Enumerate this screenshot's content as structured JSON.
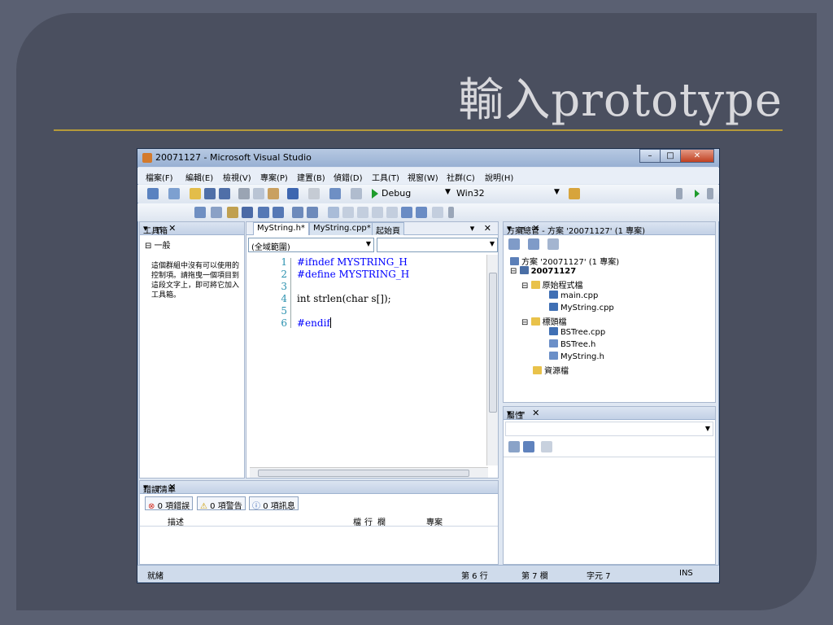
{
  "slide": {
    "title": "輸入prototype"
  },
  "window": {
    "title": "20071127 - Microsoft Visual Studio",
    "minimize": "–",
    "maximize": "□",
    "close": "✕"
  },
  "menu": [
    "檔案(F)",
    "編輯(E)",
    "檢視(V)",
    "專案(P)",
    "建置(B)",
    "偵錯(D)",
    "工具(T)",
    "視窗(W)",
    "社群(C)",
    "說明(H)"
  ],
  "toolbar": {
    "config": "Debug",
    "platform": "Win32"
  },
  "toolbox": {
    "header": "工具箱",
    "group": "⊟ 一般",
    "empty_text": "這個群組中沒有可以使用的控制項。請拖曳一個項目到這段文字上，即可將它加入工具箱。",
    "controls": "▾ ╤ ✕"
  },
  "editor": {
    "tabs": [
      "MyString.h*",
      "MyString.cpp*",
      "起始頁"
    ],
    "tab_controls": "▾ ✕",
    "scope_combo": "(全域範圍)",
    "lines": [
      {
        "num": "1",
        "text": "#ifndef MYSTRING_H"
      },
      {
        "num": "2",
        "text": "#define MYSTRING_H"
      },
      {
        "num": "3",
        "text": ""
      },
      {
        "num": "4",
        "text": "int strlen(char s[]);"
      },
      {
        "num": "5",
        "text": ""
      },
      {
        "num": "6",
        "text": "#endif"
      }
    ]
  },
  "solution": {
    "header": "方案總管 - 方案 '20071127' (1 專案)",
    "controls": "▾ ╤ ✕",
    "items": [
      {
        "label": "方案 '20071127' (1 專案)",
        "color": "#5b7fb8"
      },
      {
        "label": "20071127",
        "color": "#4a6ea5"
      },
      {
        "label": "原始程式檔",
        "color": "#e9c24a"
      },
      {
        "label": "main.cpp",
        "color": "#3f6fb4"
      },
      {
        "label": "MyString.cpp",
        "color": "#3f6fb4"
      },
      {
        "label": "標頭檔",
        "color": "#e9c24a"
      },
      {
        "label": "BSTree.cpp",
        "color": "#3f6fb4"
      },
      {
        "label": "BSTree.h",
        "color": "#6b8fc8"
      },
      {
        "label": "MyString.h",
        "color": "#6b8fc8"
      },
      {
        "label": "資源檔",
        "color": "#e9c24a"
      }
    ]
  },
  "properties": {
    "header": "屬性",
    "controls": "▾ ╤ ✕"
  },
  "errors": {
    "header": "錯誤清單",
    "controls": "▾ ╤ ✕",
    "errors_btn": "0 項錯誤",
    "warnings_btn": "0 項警告",
    "messages_btn": "0 項訊息",
    "col_desc": "描述",
    "col_file": "檔",
    "col_line": "行",
    "col_col": "欄",
    "col_project": "專案"
  },
  "status": {
    "ready": "就緒",
    "line": "第 6 行",
    "col": "第 7 欄",
    "char": "字元 7",
    "mode": "INS"
  }
}
